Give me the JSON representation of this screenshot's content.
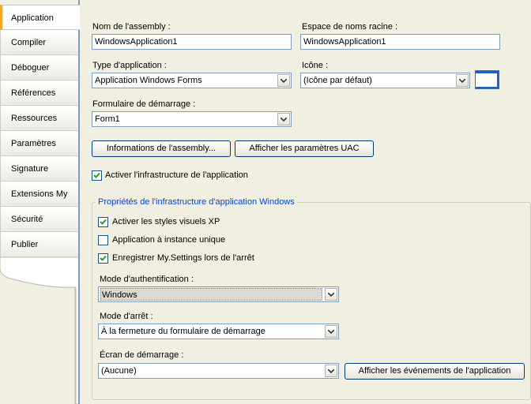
{
  "tabs": [
    {
      "label": "Application",
      "active": true
    },
    {
      "label": "Compiler"
    },
    {
      "label": "Déboguer"
    },
    {
      "label": "Références"
    },
    {
      "label": "Ressources"
    },
    {
      "label": "Paramètres"
    },
    {
      "label": "Signature"
    },
    {
      "label": "Extensions My"
    },
    {
      "label": "Sécurité"
    },
    {
      "label": "Publier"
    }
  ],
  "assembly_name": {
    "label": "Nom de l'assembly :",
    "value": "WindowsApplication1"
  },
  "root_namespace": {
    "label": "Espace de noms racine :",
    "value": "WindowsApplication1"
  },
  "app_type": {
    "label": "Type d'application :",
    "value": "Application Windows Forms"
  },
  "icon": {
    "label": "Icône :",
    "value": "(Icône par défaut)"
  },
  "startup_form": {
    "label": "Formulaire de démarrage :",
    "value": "Form1"
  },
  "buttons": {
    "assembly_info": "Informations de l'assembly...",
    "uac_settings": "Afficher les paramètres UAC",
    "app_events": "Afficher les événements de l'application"
  },
  "enable_framework": {
    "label": "Activer l'infrastructure de l'application",
    "checked": true
  },
  "framework_group": {
    "title": "Propriétés de l'infrastructure d'application Windows",
    "xp_styles": {
      "label": "Activer les styles visuels XP",
      "checked": true
    },
    "single_instance": {
      "label": "Application à instance unique",
      "checked": false
    },
    "save_settings": {
      "label": "Enregistrer My.Settings lors de l'arrêt",
      "checked": true
    },
    "auth_mode": {
      "label": "Mode d'authentification :",
      "value": "Windows"
    },
    "shutdown_mode": {
      "label": "Mode d'arrêt :",
      "value": "À la fermeture du formulaire de démarrage"
    },
    "splash_screen": {
      "label": "Écran de démarrage :",
      "value": "(Aucune)"
    }
  },
  "colors": {
    "accent_tab": "#f5a623",
    "group_title": "#0046d5",
    "border": "#7f9db9"
  }
}
